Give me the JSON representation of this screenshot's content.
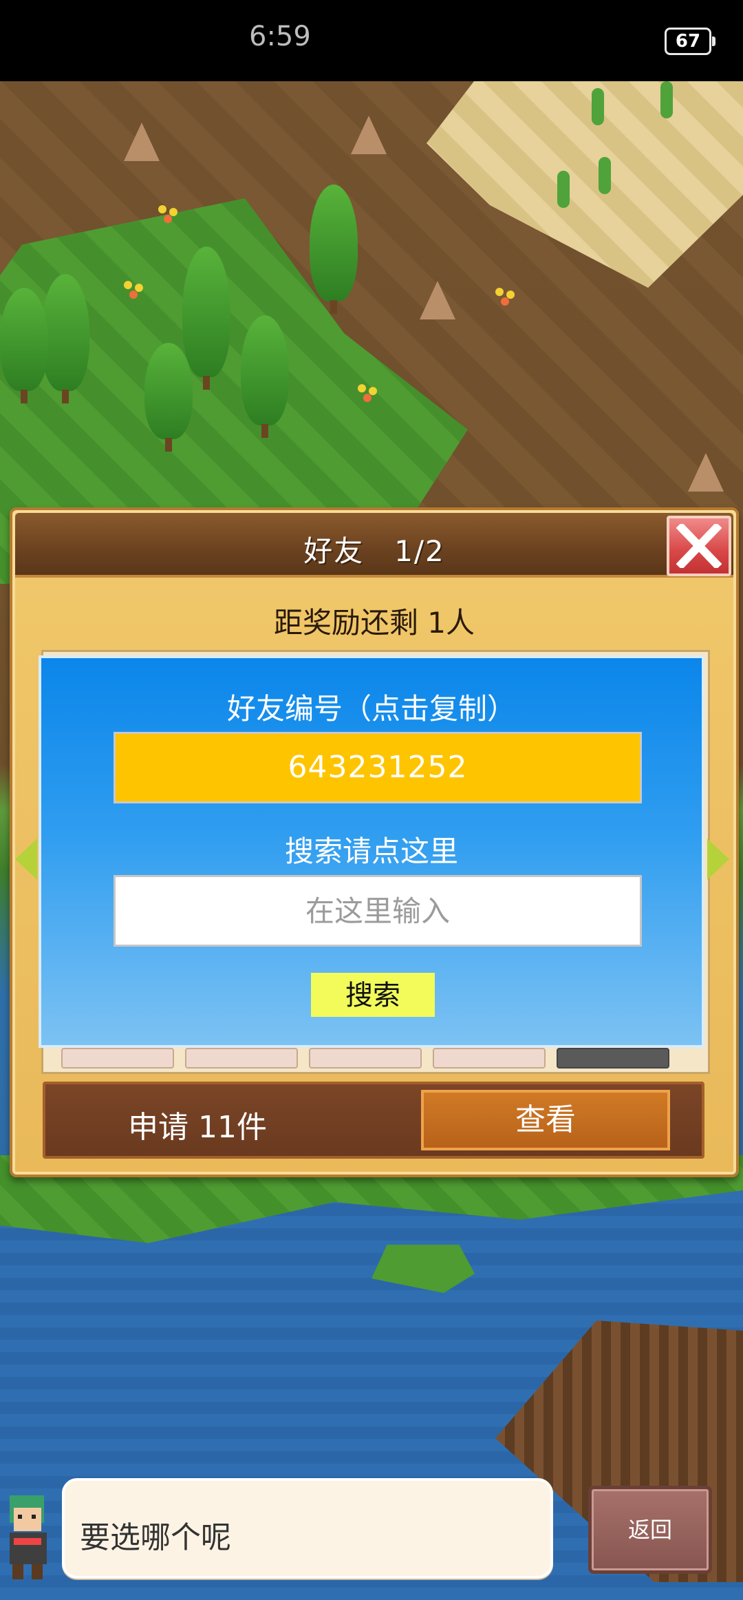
{
  "status_bar": {
    "time": "6:59",
    "battery": "67"
  },
  "panel": {
    "title": "好友　1/2",
    "reward_remaining": "距奖励还剩 1人"
  },
  "dialog": {
    "friend_id_label": "好友编号（点击复制）",
    "friend_id": "643231252",
    "search_label": "搜索请点这里",
    "search_placeholder": "在这里输入",
    "search_button": "搜索"
  },
  "applications": {
    "label": "申请 11件",
    "view_button": "查看"
  },
  "bottom": {
    "speech": "要选哪个呢",
    "back_button": "返回"
  },
  "colors": {
    "accent_blue": "#0b86ea",
    "id_box_yellow": "#ffc400",
    "search_button": "#f2fb5a",
    "close_red": "#d94747"
  }
}
